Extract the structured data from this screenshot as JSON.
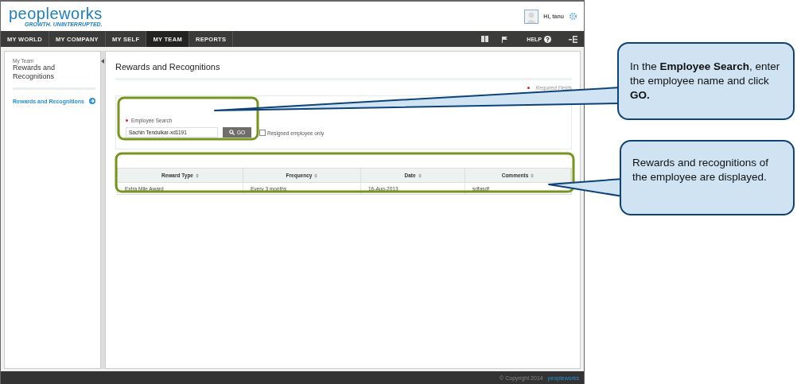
{
  "logo": {
    "name": "peopleworks",
    "tagline": "GROWTH. UNINTERRUPTED."
  },
  "user": {
    "greeting": "Hi, tanu"
  },
  "nav": [
    {
      "label": "MY WORLD",
      "selected": false
    },
    {
      "label": "MY COMPANY",
      "selected": false
    },
    {
      "label": "MY SELF",
      "selected": false
    },
    {
      "label": "MY TEAM",
      "selected": true
    },
    {
      "label": "REPORTS",
      "selected": false
    }
  ],
  "nav_right": {
    "help": "HELP"
  },
  "sidebar": {
    "section": "My Team",
    "title": "Rewards and Recognitions",
    "items": [
      {
        "label": "Rewards and Recognitions",
        "selected": true
      }
    ]
  },
  "page": {
    "title": "Rewards and Recognitions",
    "required_note": "Required Fields"
  },
  "search": {
    "label": "Employee Search",
    "required": true,
    "value": "Sachin Tendulkar-xd1191",
    "button": "GO",
    "resigned": {
      "label": "Resigned employee only",
      "checked": false
    }
  },
  "table": {
    "columns": [
      "Reward Type",
      "Frequency",
      "Date",
      "Comments"
    ],
    "rows": [
      [
        "Extra Mile Award",
        "Every 3 months",
        "16-Aug-2013",
        "sdfasdf"
      ]
    ]
  },
  "footer": {
    "copyright": "© Copyright 2014",
    "logo": "peopleworks"
  },
  "callouts": [
    {
      "text": "In the **Employee Search**, enter the employee name and click **GO.**"
    },
    {
      "text": "Rewards and recognitions of the employee are displayed."
    }
  ]
}
